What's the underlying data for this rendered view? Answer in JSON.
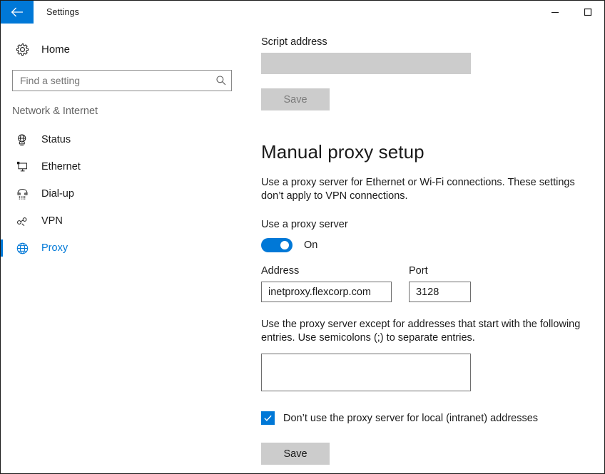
{
  "window": {
    "title": "Settings",
    "back_icon": "back-arrow-icon",
    "minimize_label": "─",
    "maximize_label": "☐",
    "accent_color": "#0078d7",
    "disabled_fill": "#cccccc"
  },
  "sidebar": {
    "home": {
      "label": "Home",
      "icon": "gear-icon"
    },
    "search": {
      "placeholder": "Find a setting",
      "value": "",
      "icon": "search-icon"
    },
    "category": "Network & Internet",
    "items": [
      {
        "label": "Status",
        "icon": "status-globe-monitor-icon",
        "selected": false
      },
      {
        "label": "Ethernet",
        "icon": "ethernet-monitor-icon",
        "selected": false
      },
      {
        "label": "Dial-up",
        "icon": "dialup-phone-icon",
        "selected": false
      },
      {
        "label": "VPN",
        "icon": "vpn-key-icon",
        "selected": false
      },
      {
        "label": "Proxy",
        "icon": "globe-icon",
        "selected": true
      }
    ]
  },
  "main": {
    "script_address": {
      "label": "Script address",
      "value": "",
      "disabled": true,
      "save_label": "Save",
      "save_disabled": true
    },
    "manual_proxy": {
      "heading": "Manual proxy setup",
      "description": "Use a proxy server for Ethernet or Wi-Fi connections. These settings don’t apply to VPN connections.",
      "toggle_label": "Use a proxy server",
      "toggle_state": "On",
      "toggle_on": true,
      "address_label": "Address",
      "address_value": "inetproxy.flexcorp.com",
      "port_label": "Port",
      "port_value": "3128",
      "exceptions_description": "Use the proxy server except for addresses that start with the following entries. Use semicolons (;) to separate entries.",
      "exceptions_value": "",
      "local_checkbox_label": "Don’t use the proxy server for local (intranet) addresses",
      "local_checkbox_checked": true,
      "save_label": "Save"
    }
  }
}
